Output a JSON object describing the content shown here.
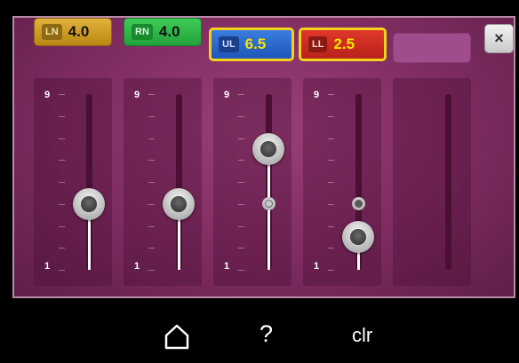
{
  "tabs": [
    {
      "key": "LN",
      "label": "LN",
      "value": "4.0",
      "color": "#d4a426",
      "selected": false
    },
    {
      "key": "RN",
      "label": "RN",
      "value": "4.0",
      "color": "#2fb84a",
      "selected": false
    },
    {
      "key": "UL",
      "label": "UL",
      "value": "6.5",
      "color": "#2d6fd3",
      "selected": true
    },
    {
      "key": "LL",
      "label": "LL",
      "value": "2.5",
      "color": "#d2302a",
      "selected": true
    }
  ],
  "close_symbol": "×",
  "sliders": [
    {
      "name": "LN",
      "max_label": "9",
      "min_label": "1",
      "min": 1,
      "max": 9,
      "value": 4.0,
      "reference": null
    },
    {
      "name": "RN",
      "max_label": "9",
      "min_label": "1",
      "min": 1,
      "max": 9,
      "value": 4.0,
      "reference": null
    },
    {
      "name": "UL",
      "max_label": "9",
      "min_label": "1",
      "min": 1,
      "max": 9,
      "value": 6.5,
      "reference": 4.0
    },
    {
      "name": "LL",
      "max_label": "9",
      "min_label": "1",
      "min": 1,
      "max": 9,
      "value": 2.5,
      "reference": 4.0
    },
    {
      "name": "empty",
      "max_label": "",
      "min_label": "",
      "min": 1,
      "max": 9,
      "value": null,
      "reference": null
    }
  ],
  "nav": {
    "home_icon": "home-icon",
    "help_label": "?",
    "clear_label": "clr"
  },
  "colors": {
    "panel": "#8a3570",
    "highlight_border": "#f2d21a"
  }
}
